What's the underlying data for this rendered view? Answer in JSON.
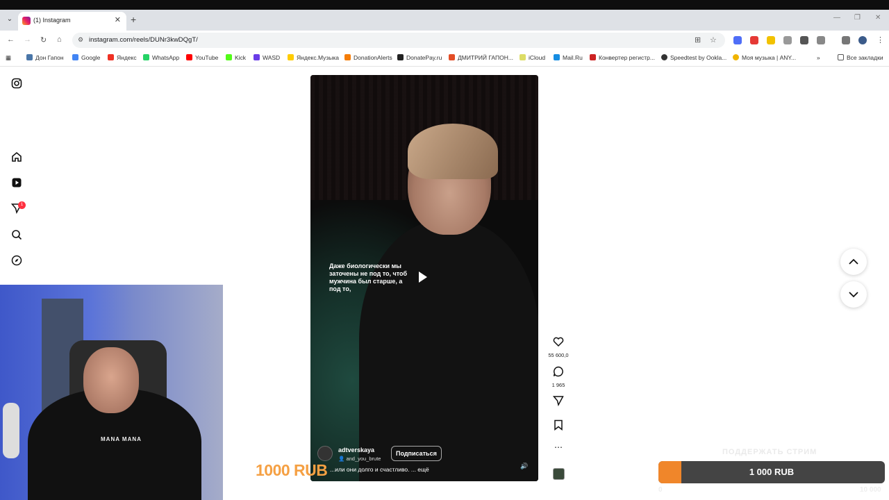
{
  "browser": {
    "tab_title": "(1) Instagram",
    "url": "instagram.com/reels/DUNr3kwDQgT/",
    "bookmarks": [
      "Дон Гапон",
      "Google",
      "Яндекс",
      "WhatsApp",
      "YouTube",
      "Kick",
      "WASD",
      "Яндекс.Музыка",
      "DonationAlerts",
      "DonatePay.ru",
      "ДМИТРИЙ ГАПОН...",
      "iCloud",
      "Mail.Ru",
      "Конвертер регистр...",
      "Speedtest by Ookla...",
      "Моя музыка | ANY..."
    ],
    "all_bookmarks": "Все закладки",
    "bookmark_colors": [
      "#4a76a8",
      "#4285f4",
      "#ef3124",
      "#25d366",
      "#ff0000",
      "#53fc18",
      "#6a3de8",
      "#ffcc00",
      "#f57d07",
      "#222222",
      "#e34d26",
      "#dddd66",
      "#168de2",
      "#cc2222",
      "#333333",
      "#f0b400"
    ]
  },
  "sidebar": {
    "notification_badge": "1"
  },
  "reel": {
    "caption": "Даже биологически мы заточены не под то, чтоб мужчина был старше, а под то,",
    "author": "adtverskaya",
    "co_author": "and_you_brute",
    "follow_label": "Подписаться",
    "description": "...или они долго и счастливо. ... ещё"
  },
  "actions": {
    "likes": "55 600,0",
    "comments": "1 965"
  },
  "overlay": {
    "left_amount": "1000 RUB",
    "support_text": "ПОДДЕРЖАТЬ СТРИМ",
    "donation_value": "1 000 RUB",
    "donation_progress": 0.1,
    "min_label": "0",
    "max_label": "10 000",
    "shirt_print": "MANA MANA",
    "accent": "#f0862a"
  }
}
